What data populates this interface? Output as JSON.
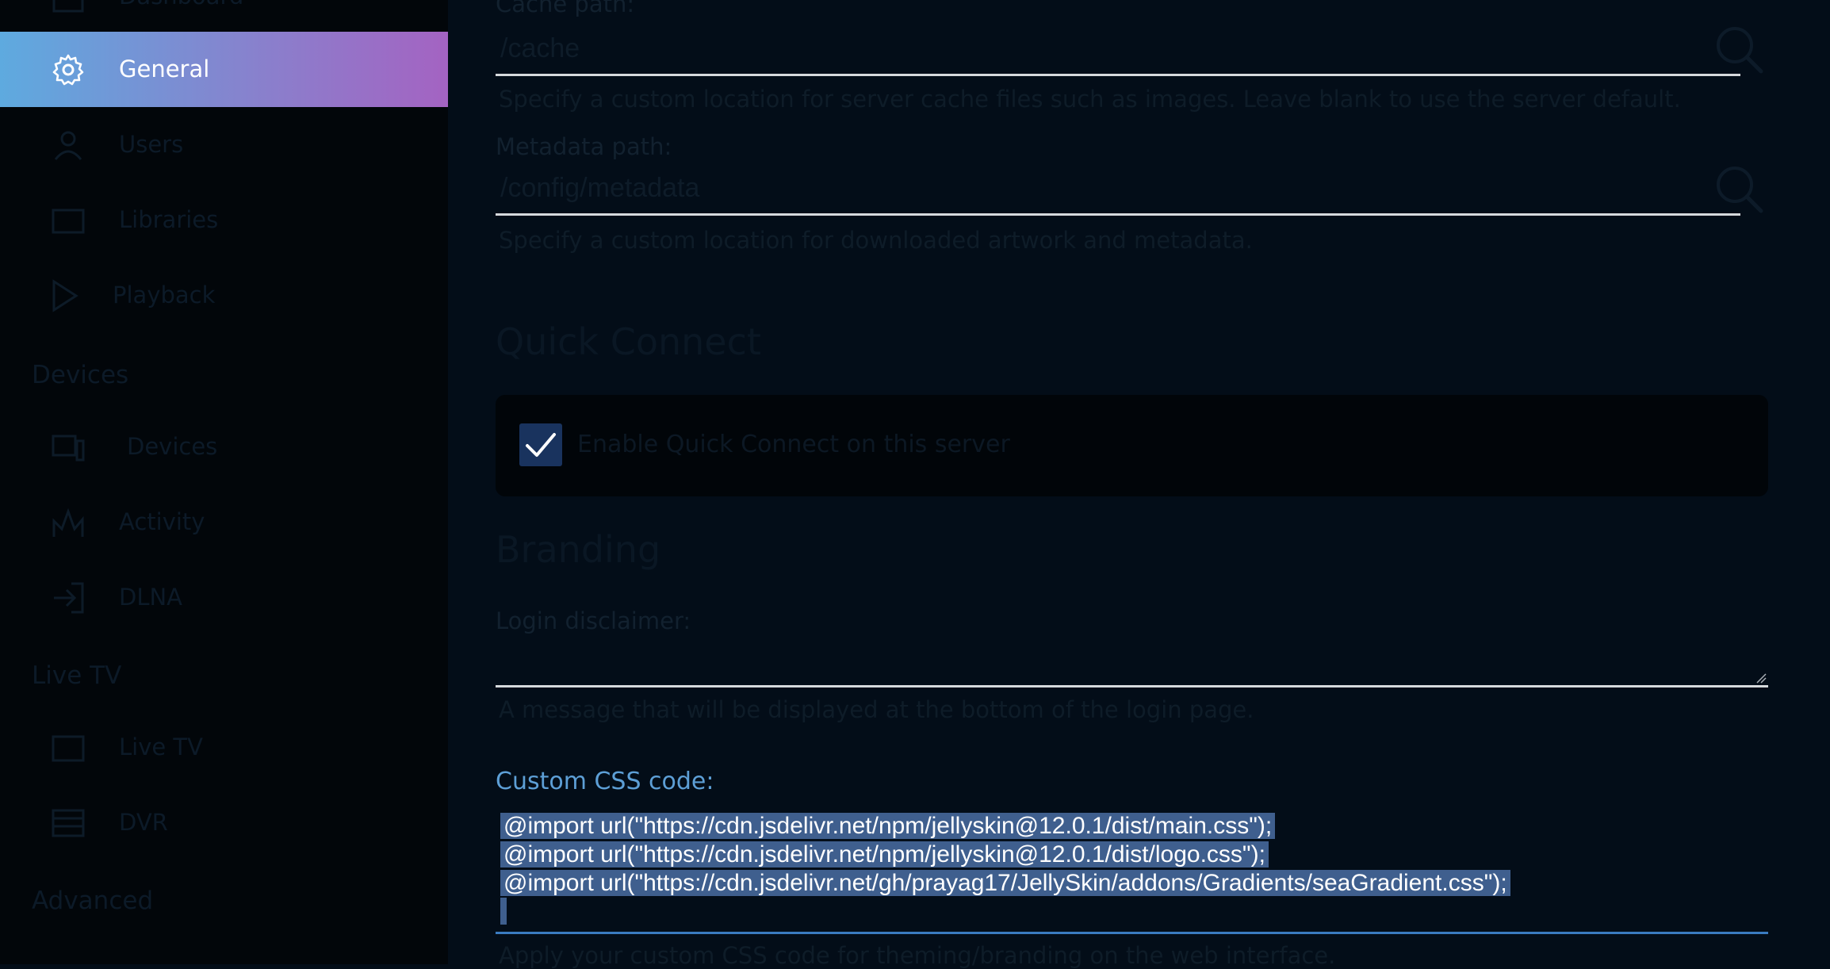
{
  "sidebar": {
    "top_partial_label": "Dashboard",
    "items": [
      {
        "label": "General",
        "icon": "gear-icon",
        "active": true
      },
      {
        "label": "Users",
        "icon": "users-icon"
      },
      {
        "label": "Libraries",
        "icon": "folder-icon"
      },
      {
        "label": "Playback",
        "icon": "play-icon"
      }
    ],
    "devices_section": "Devices",
    "devices_items": [
      {
        "label": "Devices",
        "icon": "devices-icon"
      },
      {
        "label": "Activity",
        "icon": "activity-icon"
      },
      {
        "label": "DLNA",
        "icon": "dlna-icon"
      }
    ],
    "livetv_section": "Live TV",
    "livetv_items": [
      {
        "label": "Live TV",
        "icon": "tv-icon"
      },
      {
        "label": "DVR",
        "icon": "dvr-icon"
      }
    ],
    "advanced_section": "Advanced"
  },
  "paths": {
    "cache_label": "Cache path:",
    "cache_value": "/cache",
    "cache_help": "Specify a custom location for server cache files such as images. Leave blank to use the server default.",
    "metadata_label": "Metadata path:",
    "metadata_value": "/config/metadata",
    "metadata_help": "Specify a custom location for downloaded artwork and metadata."
  },
  "quick_connect": {
    "title": "Quick Connect",
    "checkbox_label": "Enable Quick Connect on this server",
    "checked": true
  },
  "branding": {
    "title": "Branding",
    "disclaimer_label": "Login disclaimer:",
    "disclaimer_help": "A message that will be displayed at the bottom of the login page.",
    "css_label": "Custom CSS code:",
    "css_lines": [
      "@import url(\"https://cdn.jsdelivr.net/npm/jellyskin@12.0.1/dist/main.css\");",
      "@import url(\"https://cdn.jsdelivr.net/npm/jellyskin@12.0.1/dist/logo.css\");",
      "@import url(\"https://cdn.jsdelivr.net/gh/prayag17/JellySkin/addons/Gradients/seaGradient.css\");"
    ],
    "css_help": "Apply your custom CSS code for theming/branding on the web interface."
  },
  "colors": {
    "sidebar_active_gradient": [
      "#5eaadf",
      "#a463c2"
    ],
    "accent": "#5d9fd6",
    "checkbox": "#19335e",
    "selection": "#3f5f8e"
  }
}
